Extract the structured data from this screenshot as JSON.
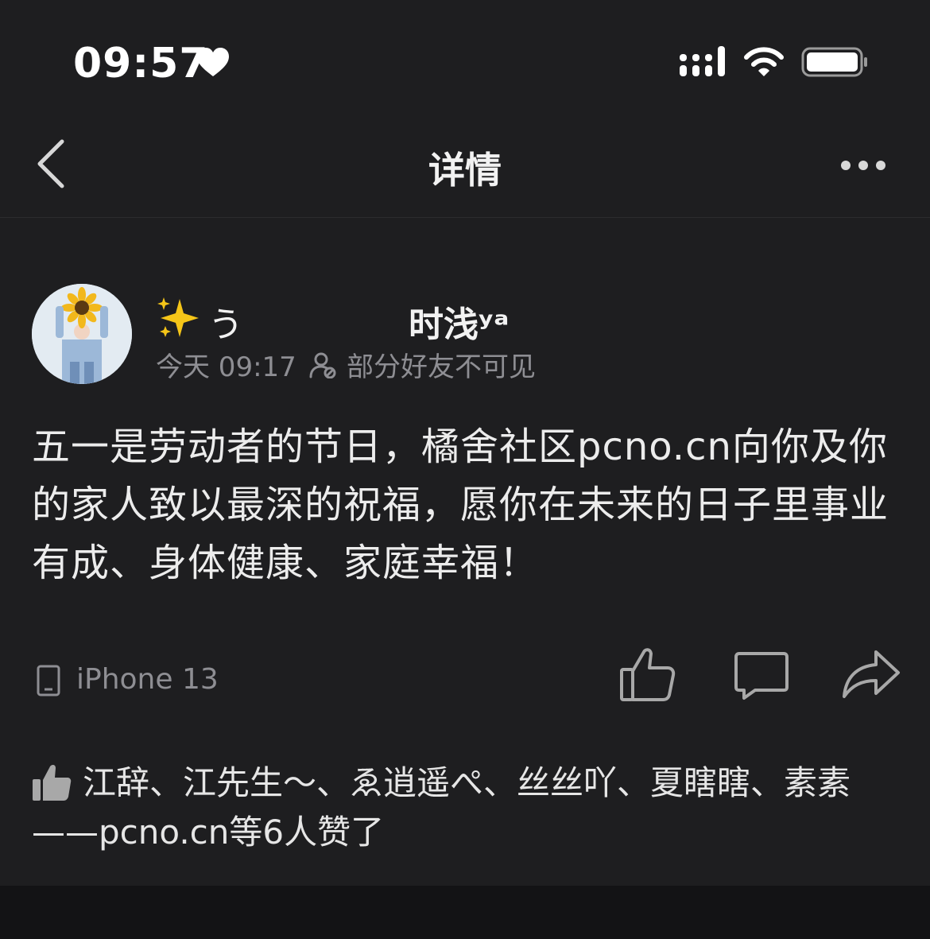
{
  "status_bar": {
    "time": "09:57",
    "icons": [
      "heart-icon",
      "signal-icon",
      "wifi-icon",
      "battery-icon"
    ]
  },
  "nav": {
    "title": "详情",
    "back_icon": "chevron-left-icon",
    "more_icon": "more-dots-icon"
  },
  "post": {
    "author": {
      "name_prefix": "う",
      "name": "时浅ʸᵃ",
      "avatar": "sunflower-girl-avatar"
    },
    "time": "今天 09:17",
    "visibility": "部分好友不可见",
    "body": "五一是劳动者的节日，橘舍社区pcno.cn向你及你的家人致以最深的祝福，愿你在未来的日子里事业有成、身体健康、家庭幸福！",
    "device": "iPhone 13",
    "actions": [
      "like-icon",
      "comment-icon",
      "share-icon"
    ]
  },
  "likes": {
    "text": "江辞、江先生～、ゑ逍遥ぺ、丝丝吖、夏瞎瞎、素素——pcno.cn等6人赞了"
  },
  "colors": {
    "background": "#1e1e20",
    "text": "#ececec",
    "secondary": "#8e8e93",
    "bottom_strip": "#131315"
  }
}
